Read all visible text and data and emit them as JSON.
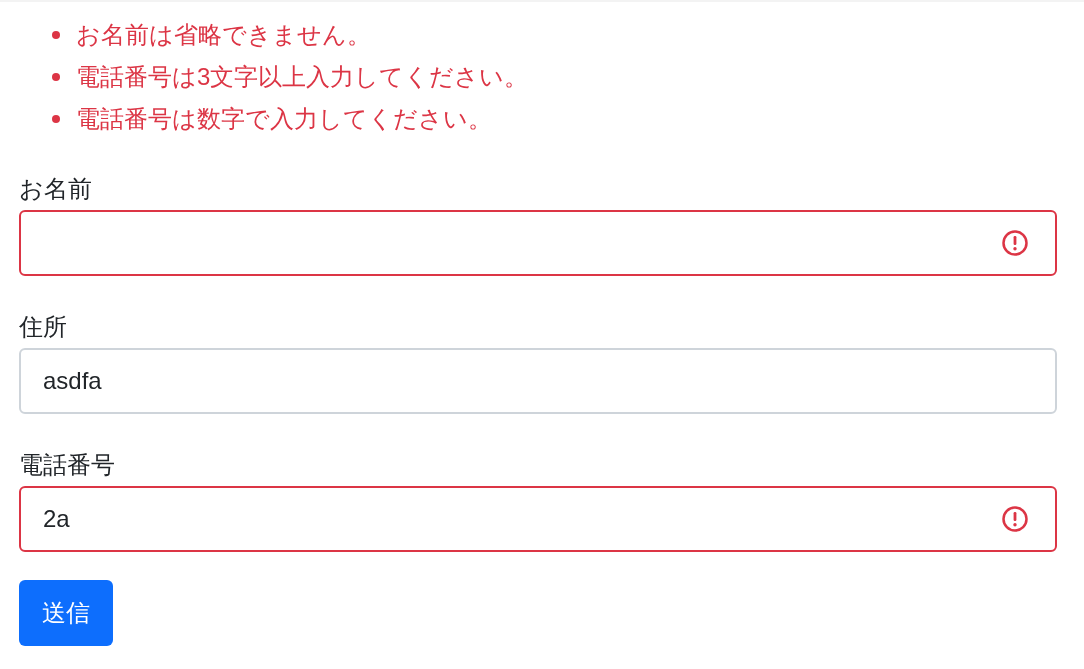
{
  "errors": [
    "お名前は省略できません。",
    "電話番号は3文字以上入力してください。",
    "電話番号は数字で入力してください。"
  ],
  "fields": [
    {
      "label": "お名前",
      "invalid": true
    },
    {
      "label": "住所",
      "value": "asdfa",
      "invalid": false
    },
    {
      "label": "電話番号",
      "value": "2a",
      "invalid": true
    }
  ],
  "submit": {
    "label": "送信"
  }
}
